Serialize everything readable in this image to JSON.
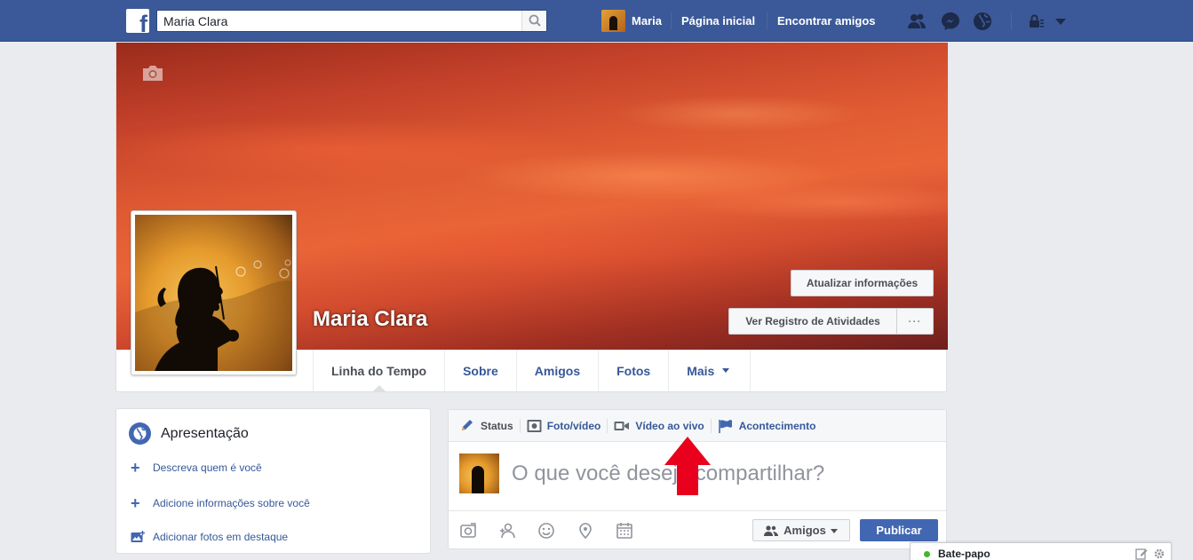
{
  "topbar": {
    "logo_letter": "f",
    "search_value": "Maria Clara",
    "user_name": "Maria",
    "home_label": "Página inicial",
    "find_friends_label": "Encontrar amigos"
  },
  "profile": {
    "name": "Maria Clara",
    "update_info_button": "Atualizar informações",
    "activity_log_button": "Ver Registro de Atividades",
    "more_button": "···"
  },
  "tabs": [
    {
      "label": "Linha do Tempo",
      "active": true
    },
    {
      "label": "Sobre"
    },
    {
      "label": "Amigos"
    },
    {
      "label": "Fotos"
    },
    {
      "label": "Mais"
    }
  ],
  "intro": {
    "title": "Apresentação",
    "items": [
      {
        "label": "Descreva quem é você",
        "icon": "plus-icon"
      },
      {
        "label": "Adicione informações sobre você",
        "icon": "plus-icon"
      },
      {
        "label": "Adicionar fotos em destaque",
        "icon": "add-photo-icon"
      }
    ]
  },
  "composer": {
    "tabs": [
      {
        "label": "Status",
        "icon": "pencil-icon"
      },
      {
        "label": "Foto/vídeo",
        "icon": "camera-icon"
      },
      {
        "label": "Vídeo ao vivo",
        "icon": "video-camera-icon"
      },
      {
        "label": "Acontecimento",
        "icon": "flag-icon"
      }
    ],
    "placeholder": "O que você deseja compartilhar?",
    "audience_button": "Amigos",
    "publish_button": "Publicar"
  },
  "chat": {
    "label": "Bate-papo"
  },
  "colors": {
    "brand": "#3b5998",
    "link": "#365899",
    "publish": "#4267b2",
    "annotation_arrow": "#e8001c",
    "online": "#42b72a"
  }
}
